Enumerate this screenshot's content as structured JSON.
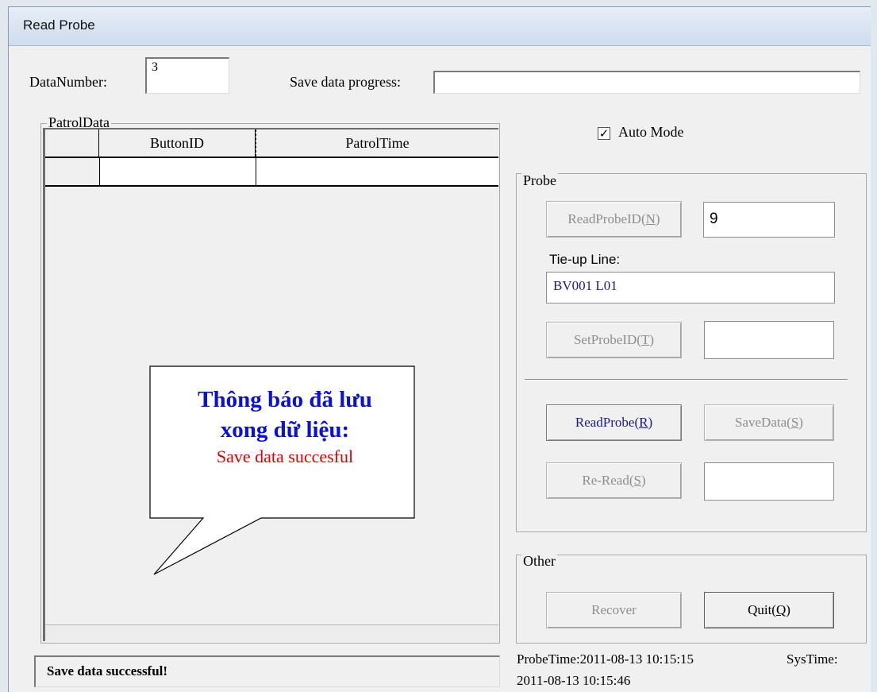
{
  "window": {
    "title": "Read Probe"
  },
  "top": {
    "data_number_label": "DataNumber:",
    "data_number_value": "3",
    "save_progress_label": "Save data progress:",
    "save_progress": 0
  },
  "patrol": {
    "legend": "PatrolData",
    "columns": [
      "ButtonID",
      "PatrolTime"
    ]
  },
  "auto_mode": {
    "label": "Auto Mode",
    "checked": true
  },
  "probe": {
    "legend": "Probe",
    "read_id_text": "ReadProbeID(",
    "read_id_key": "N",
    "probe_id_value": "9",
    "tieup_label": "Tie-up Line:",
    "tieup_value": "BV001 L01",
    "set_id_text": "SetProbeID(",
    "set_id_key": "T",
    "read_probe_text": "ReadProbe(",
    "read_probe_key": "R",
    "save_data_text": "SaveData(",
    "save_data_key": "S",
    "reread_text": "Re-Read(",
    "reread_key": "S"
  },
  "other": {
    "legend": "Other",
    "recover_label": "Recover",
    "quit_text": "Quit(",
    "quit_key": "Q"
  },
  "status": {
    "message": "Save data successful!",
    "probe_time": "ProbeTime:2011-08-13 10:15:15",
    "sys_time_label": "SysTime:",
    "sys_time_value": "2011-08-13 10:15:46"
  },
  "callout": {
    "line1": "Thông báo đã lưu",
    "line2": "xong dữ liệu:",
    "line3": "Save data succesful"
  },
  "colors": {
    "callout_title": "#0b10d8",
    "callout_sub": "#e00000",
    "active_button": "#1a1a8c"
  }
}
